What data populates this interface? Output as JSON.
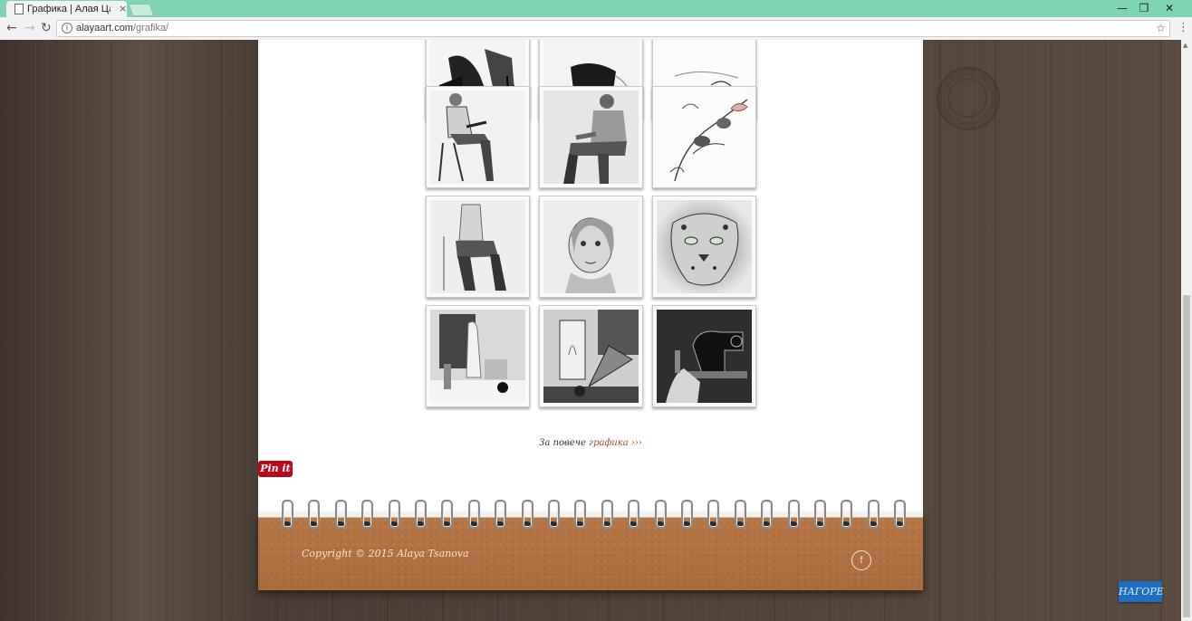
{
  "browser": {
    "tab_title": "Графика | Алая Цан",
    "tab_close": "×",
    "url_host": "alayaart.com",
    "url_path": "/grafika/",
    "back_icon": "arrow-left-icon",
    "forward_icon": "arrow-right-icon",
    "reload_icon": "reload-icon",
    "minimize": "—",
    "restore": "❐",
    "close": "✕",
    "star": "☆",
    "menu": "⋮"
  },
  "gallery": {
    "items": [
      {
        "subject": "ink drawing"
      },
      {
        "subject": "ink drawing"
      },
      {
        "subject": "line sketch"
      },
      {
        "subject": "seated man"
      },
      {
        "subject": "seated man in sweater"
      },
      {
        "subject": "birds on branch"
      },
      {
        "subject": "seated figure"
      },
      {
        "subject": "portrait of woman"
      },
      {
        "subject": "snow leopard"
      },
      {
        "subject": "still life with statue"
      },
      {
        "subject": "still life with fan"
      },
      {
        "subject": "sewing machine"
      }
    ]
  },
  "more_link": {
    "prefix": "За повече ",
    "link_text": "графика ›››"
  },
  "pinit_label": "Pin it",
  "footer": {
    "copyright": "Copyright © 2015 Alaya Tsanova",
    "facebook_icon": "f",
    "to_top_label": "НАГОРЕ"
  },
  "colors": {
    "titlebar": "#7fd5b1",
    "pinit": "#bd081c",
    "to_top": "#1e6fc4",
    "cork": "#b07244",
    "link": "#a0522d"
  }
}
